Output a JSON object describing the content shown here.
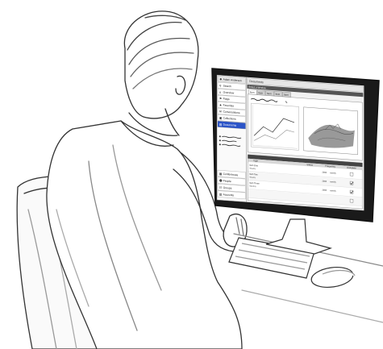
{
  "sidebar": {
    "user_name": "Adam Anderson",
    "items": [
      {
        "label": "Search",
        "icon": "search-icon"
      },
      {
        "label": "Overview",
        "icon": "home-icon"
      },
      {
        "label": "Flags",
        "icon": "flag-icon"
      },
      {
        "label": "Favorites",
        "icon": "star-icon"
      },
      {
        "label": "Conversations",
        "icon": "chat-icon"
      },
      {
        "label": "Collections",
        "icon": "folder-icon"
      },
      {
        "label": "Documents",
        "icon": "document-icon",
        "selected": true
      }
    ],
    "bottom_items": [
      {
        "label": "Conferences",
        "icon": "calendar-icon"
      },
      {
        "label": "People",
        "icon": "person-icon"
      },
      {
        "label": "Groups",
        "icon": "group-icon"
      },
      {
        "label": "Accounts",
        "icon": "account-icon"
      }
    ]
  },
  "main": {
    "header_title": "Documents",
    "subheader": "Select a Window",
    "tabs": [
      "Item",
      "Item",
      "Item",
      "Item",
      "Item"
    ],
    "table": {
      "headers": [
        "Type",
        "Status",
        "Frequency",
        "Complete"
      ],
      "rows": [
        {
          "name": "Item One",
          "sub": "Weekly",
          "status": "",
          "frequency": "2000",
          "period": "weekly",
          "complete": false
        },
        {
          "name": "Item Two",
          "sub": "Weekly",
          "status": "",
          "frequency": "2000",
          "period": "weekly",
          "complete": true
        },
        {
          "name": "Item Three",
          "sub": "Monthly",
          "status": "",
          "frequency": "2000",
          "period": "weekly",
          "complete": true
        },
        {
          "name": "",
          "sub": "",
          "status": "",
          "frequency": "",
          "period": "",
          "complete": false
        }
      ]
    }
  },
  "colors": {
    "selected": "#2b54c8",
    "screen_dark": "#1a1a1a",
    "window_bg": "#f2f2f2"
  }
}
